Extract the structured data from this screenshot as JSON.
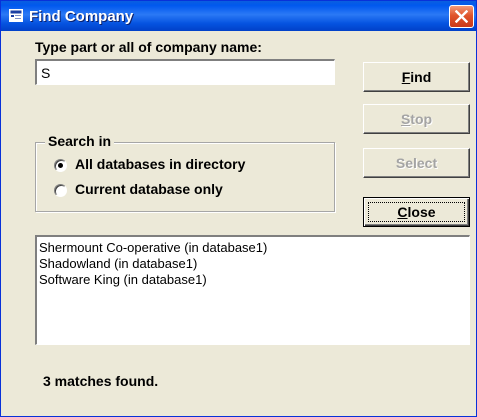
{
  "window": {
    "title": "Find Company"
  },
  "search": {
    "label": "Type part or all of company name:",
    "value": "S"
  },
  "search_in": {
    "legend": "Search in",
    "options": [
      {
        "label": "All databases in directory",
        "checked": true
      },
      {
        "label": "Current database only",
        "checked": false
      }
    ]
  },
  "buttons": {
    "find": "Find",
    "stop": "Stop",
    "select": "Select",
    "close": "Close"
  },
  "results": [
    "Shermount Co-operative (in database1)",
    "Shadowland  (in database1)",
    "Software King (in database1)"
  ],
  "status": "3 matches found."
}
